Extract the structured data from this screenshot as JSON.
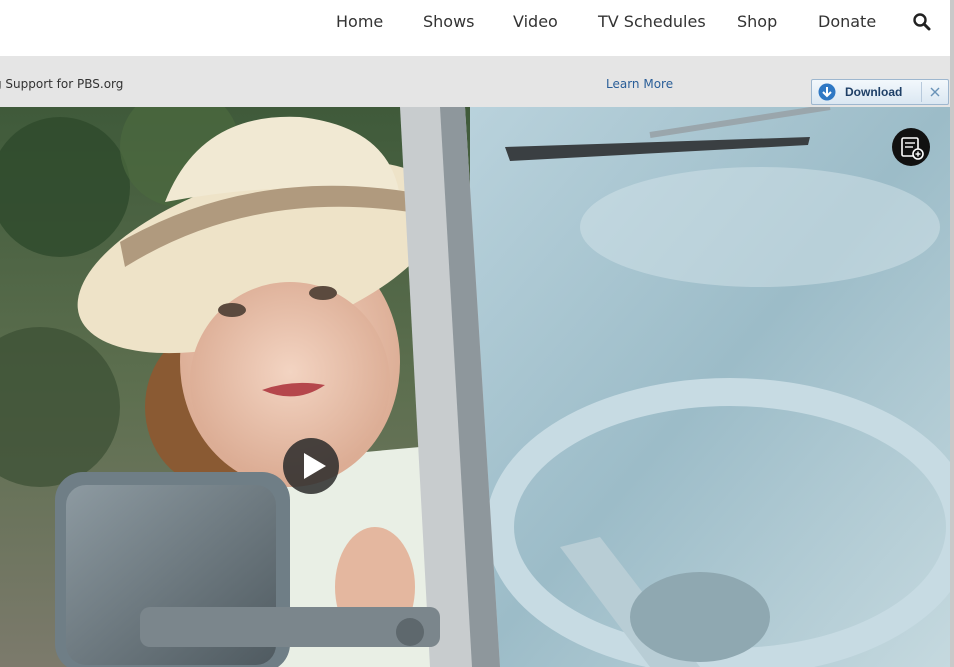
{
  "nav": {
    "items": [
      {
        "label": "Home"
      },
      {
        "label": "Shows"
      },
      {
        "label": "Video"
      },
      {
        "label": "TV Schedules"
      },
      {
        "label": "Shop"
      },
      {
        "label": "Donate"
      }
    ],
    "search_icon": "search-icon"
  },
  "sponsor": {
    "text": "g Support for PBS.org",
    "link": "Learn More"
  },
  "download_widget": {
    "label": "Download",
    "icon": "download-arrow-icon",
    "close_icon": "close-icon"
  },
  "hero": {
    "play_icon": "play-icon",
    "badge_icon": "video-download-icon"
  },
  "colors": {
    "link": "#2a5e98",
    "nav_text": "#333333",
    "sponsor_bg": "#e5e5e5"
  }
}
